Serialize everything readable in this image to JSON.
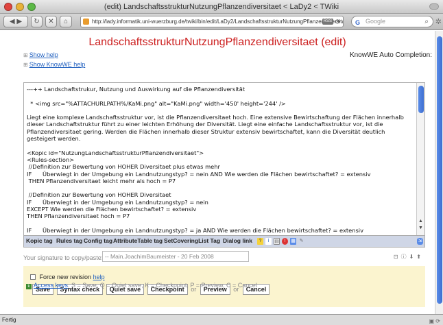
{
  "window": {
    "title": "(edit) LandschaftsstrukturNutzungPflanzendiversitaet < LaDy2 < TWiki"
  },
  "toolbar": {
    "url": "http://lady.informatik.uni-wuerzburg.de/twiki/bin/edit/LaDy2/LandschaftsstrukturNutzungPflanzendiversitaet?twiki_red",
    "rss_badge": "RSS",
    "search_placeholder": "Google"
  },
  "page": {
    "title": "LandschaftsstrukturNutzungPflanzendiversitaet (edit)",
    "show_help": "Show help",
    "show_knowwe_help": "Show KnowWE help",
    "autocompletion": "KnowWE Auto Completion:"
  },
  "editor": {
    "lines": [
      "---++ Landschaftstrukur, Nutzung und Auswirkung auf die Pflanzendiversität",
      "",
      "  * <img src=\"%ATTACHURLPATH%/KaMi.png\" alt=\"KaMi.png\" width='450' height='244' />",
      "",
      "Liegt eine komplexe Landschaftsstruktur vor, ist die Pflanzendiversitaet hoch. Eine extensive Bewirtschaftung der Flächen innerhalb dieser Landschaftstruktur führt zu einer leichten Erhöhung der Diversität. Liegt eine einfache Landschaftsstruktur vor, ist die Pflanzendiversitaet gering. Werden die Flächen innerhalb dieser Struktur extensiv bewirtschaftet, kann die Diversität deutlich gesteigert werden.",
      "",
      "<Kopic id=\"NutzungLandschaftsstrukturPflanzendiversitaet\">",
      "<Rules-section>",
      " //Definition zur Bewertung von HOHER Diversitaet plus etwas mehr",
      "IF      Überwiegt in der Umgebung ein Landnutzungstyp? = nein AND Wie werden die Flächen bewirtschaftet? = extensiv",
      " THEN Pflanzendiversitaet leicht mehr als hoch = P7",
      "",
      " //Definition zur Bewertung von HOHER Diversitaet",
      "IF      Überwiegt in der Umgebung ein Landnutzungstyp? = nein",
      "EXCEPT Wie werden die Flächen bewirtschaftet? = extensiv",
      "THEN Pflanzendiversitaet hoch = P7",
      "",
      "IF      Überwiegt in der Umgebung ein Landnutzungstyp? = ja AND Wie werden die Flächen bewirtschaftet? = extensiv",
      "THEN Pflanzendiversitaet hoch = P7"
    ]
  },
  "tagbar": {
    "buttons": [
      "Kopic tag",
      "Rules tag",
      "Config tag",
      "AttributeTable tag",
      "SetCoveringList Tag",
      "Dialog link"
    ]
  },
  "signature": {
    "label": "Your signature to copy/paste:",
    "value": "-- Main.JoachimBaumeister - 20 Feb 2008"
  },
  "save": {
    "force_label": "Force new revision",
    "help_link": "help",
    "save": "Save",
    "syntax_check": "Syntax check",
    "quiet_save": "Quiet save",
    "checkpoint": "Checkpoint",
    "or1": "or",
    "preview": "Preview",
    "or2": "or",
    "cancel": "Cancel"
  },
  "access": {
    "link": "Access keys",
    "text": ": S = Save, Q = Quiet save, K = Checkpoint, P = Preview, C = Cancel"
  },
  "status": {
    "text": "Fertig"
  }
}
